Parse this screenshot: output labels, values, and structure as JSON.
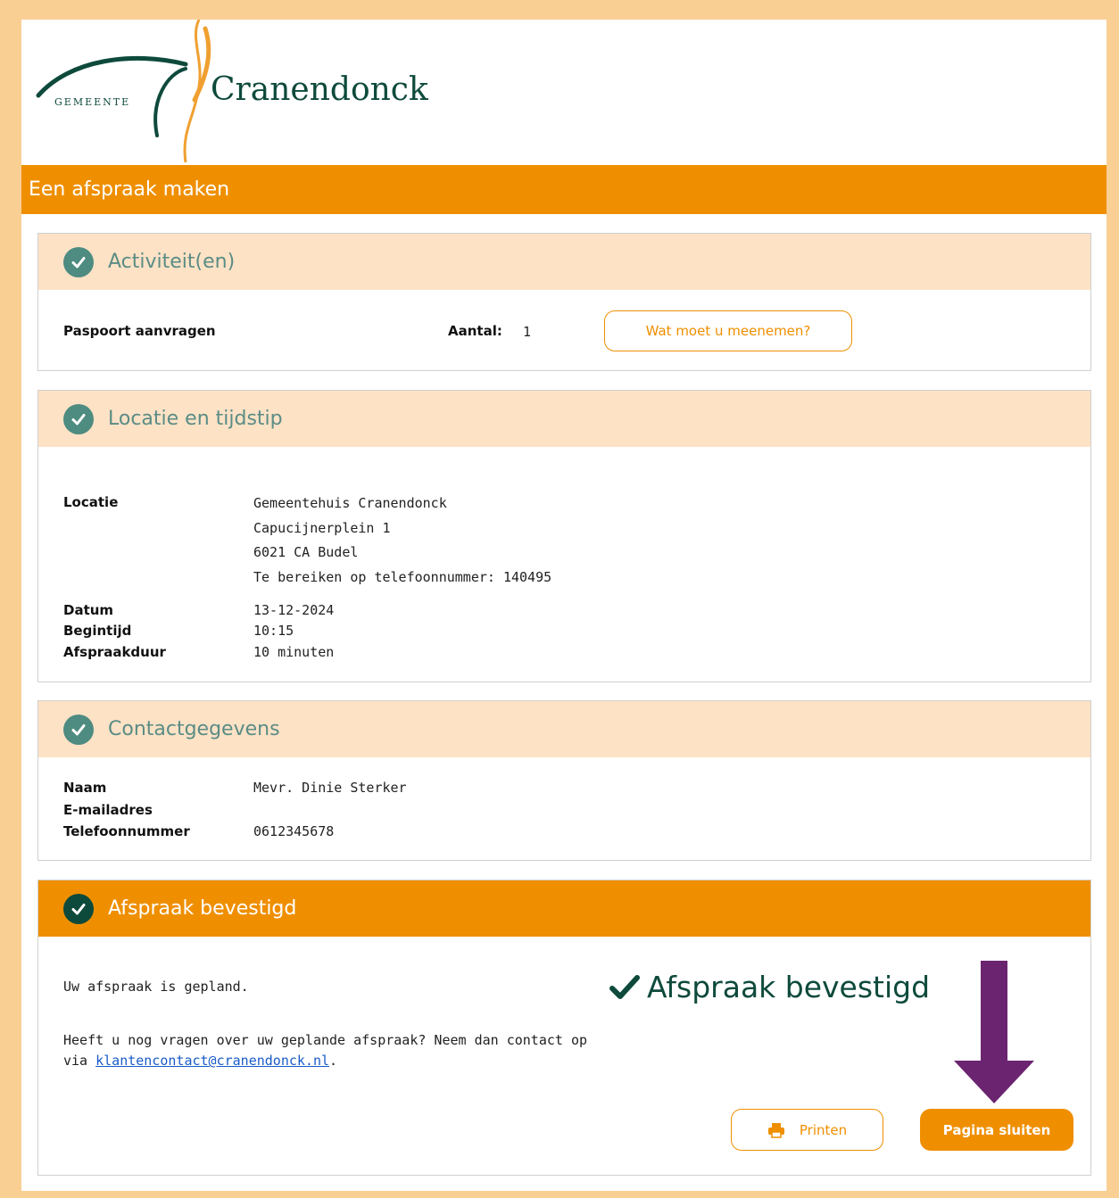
{
  "brand": {
    "prefix": "GEMEENTE",
    "name": "Cranendonck"
  },
  "page": {
    "title": "Een afspraak maken"
  },
  "activities": {
    "heading": "Activiteit(en)",
    "item_label": "Paspoort aanvragen",
    "count_label": "Aantal:",
    "count_value": "1",
    "info_button": "Wat moet u meenemen?"
  },
  "location": {
    "heading": "Locatie en tijdstip",
    "location_label": "Locatie",
    "address": [
      "Gemeentehuis Cranendonck",
      "Capucijnerplein 1",
      "6021 CA Budel",
      "Te bereiken op telefoonnummer: 140495"
    ],
    "date_label": "Datum",
    "date_value": "13-12-2024",
    "start_label": "Begintijd",
    "start_value": "10:15",
    "duration_label": "Afspraakduur",
    "duration_value": "10 minuten"
  },
  "contact": {
    "heading": "Contactgegevens",
    "name_label": "Naam",
    "name_value": "Mevr. Dinie Sterker",
    "email_label": "E-mailadres",
    "email_value": "",
    "phone_label": "Telefoonnummer",
    "phone_value": "0612345678"
  },
  "confirmation": {
    "heading": "Afspraak bevestigd",
    "planned_text": "Uw afspraak is gepland.",
    "question_text": "Heeft u nog vragen over uw geplande afspraak? Neem dan contact op",
    "via_text": "via ",
    "email_link": "klantencontact@cranendonck.nl",
    "period": ".",
    "big_status": "Afspraak bevestigd",
    "print_button": "Printen",
    "close_button": "Pagina sluiten"
  },
  "colors": {
    "accent": "#ef8f00",
    "panel_header": "#fde2c6",
    "check_green": "#4e8b80",
    "dark_green": "#0e4a3c",
    "annotation_arrow": "#6b2470"
  }
}
